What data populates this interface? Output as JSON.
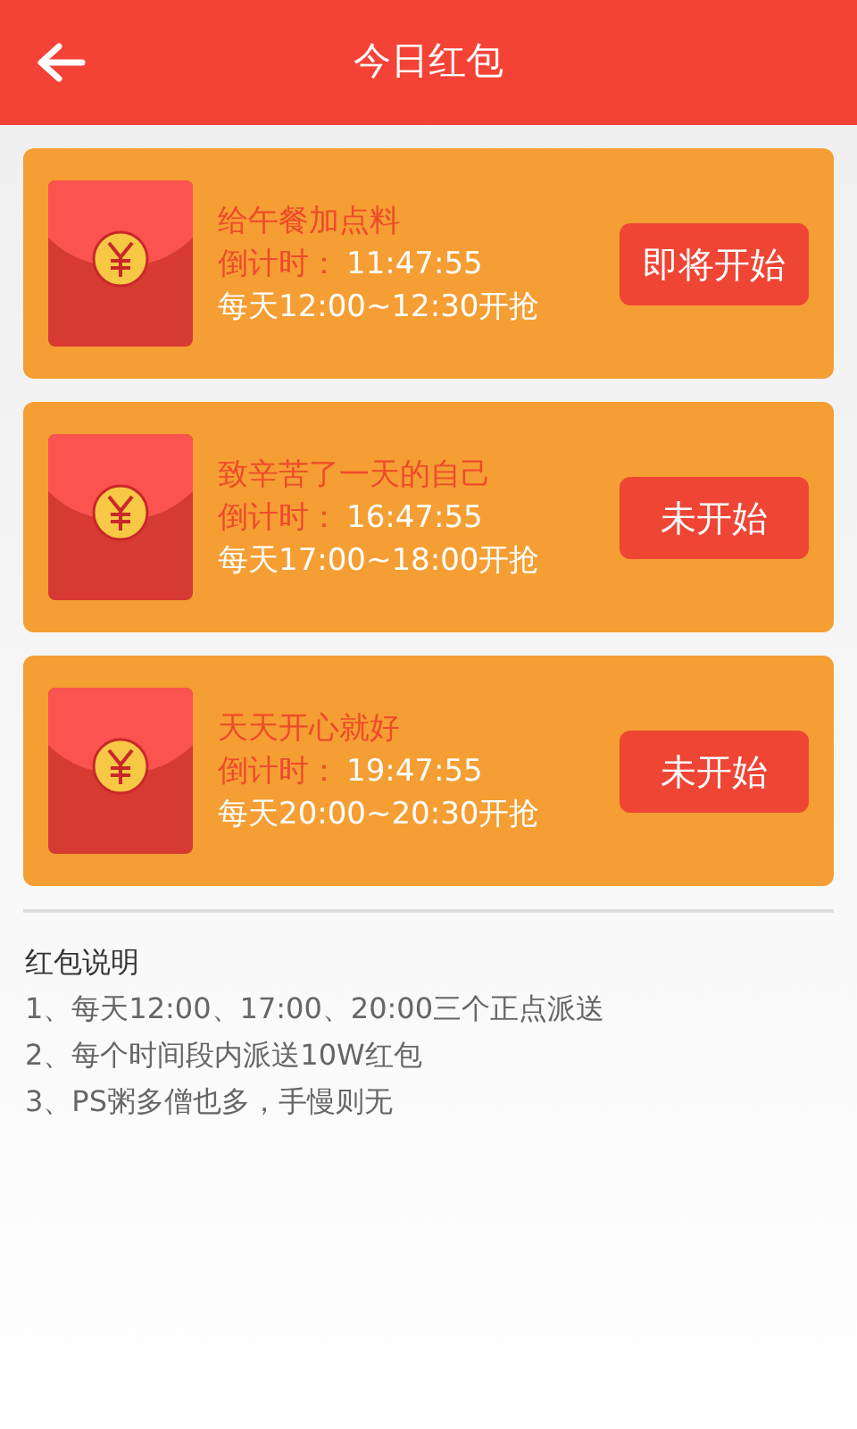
{
  "header": {
    "title": "今日红包"
  },
  "packets": [
    {
      "name": "给午餐加点料",
      "countdown_label": "倒计时：",
      "countdown": "11:47:55",
      "schedule": "每天12:00~12:30开抢",
      "button": "即将开始"
    },
    {
      "name": "致辛苦了一天的自己",
      "countdown_label": "倒计时：",
      "countdown": "16:47:55",
      "schedule": "每天17:00~18:00开抢",
      "button": "未开始"
    },
    {
      "name": "天天开心就好",
      "countdown_label": "倒计时：",
      "countdown": "19:47:55",
      "schedule": "每天20:00~20:30开抢",
      "button": "未开始"
    }
  ],
  "notes": {
    "title": "红包说明",
    "lines": [
      "1、每天12:00、17:00、20:00三个正点派送",
      "2、每个时间段内派送10W红包",
      "3、PS粥多僧也多，手慢则无"
    ]
  }
}
